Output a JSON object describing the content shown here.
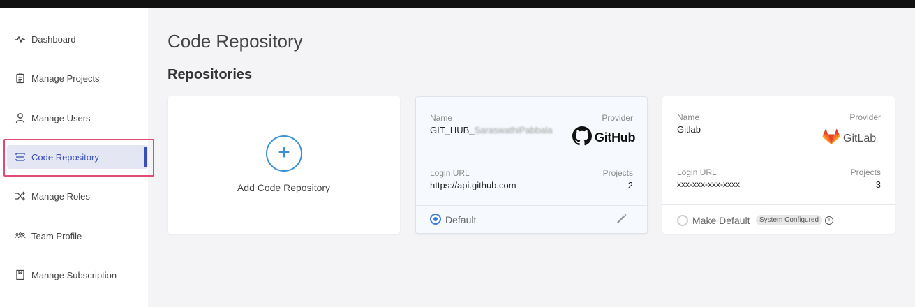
{
  "sidebar": {
    "items": [
      {
        "label": "Dashboard",
        "icon": "activity-icon"
      },
      {
        "label": "Manage Projects",
        "icon": "clipboard-icon"
      },
      {
        "label": "Manage Users",
        "icon": "user-icon"
      },
      {
        "label": "Code Repository",
        "icon": "stack-icon",
        "active": true
      },
      {
        "label": "Manage Roles",
        "icon": "shuffle-icon"
      },
      {
        "label": "Team Profile",
        "icon": "team-icon"
      },
      {
        "label": "Manage Subscription",
        "icon": "bookmark-icon"
      }
    ]
  },
  "main": {
    "page_title": "Code Repository",
    "section_title": "Repositories",
    "add_card_label": "Add Code Repository",
    "repos": [
      {
        "name_label": "Name",
        "name": "GIT_HUB_",
        "name_redacted": "SaraswathiPabbala",
        "provider_label": "Provider",
        "provider": "GitHub",
        "login_url_label": "Login URL",
        "login_url": "https://api.github.com",
        "projects_label": "Projects",
        "projects": "2",
        "default_label": "Default",
        "is_default": true
      },
      {
        "name_label": "Name",
        "name": "Gitlab",
        "provider_label": "Provider",
        "provider": "GitLab",
        "login_url_label": "Login URL",
        "login_url": "xxx-xxx-xxx-xxxx",
        "projects_label": "Projects",
        "projects": "3",
        "default_label": "Make Default",
        "badge": "System Configured",
        "is_default": false
      }
    ]
  },
  "colors": {
    "accent": "#3a4fb5",
    "highlight": "#e04b73",
    "add_blue": "#3b8fd6"
  }
}
